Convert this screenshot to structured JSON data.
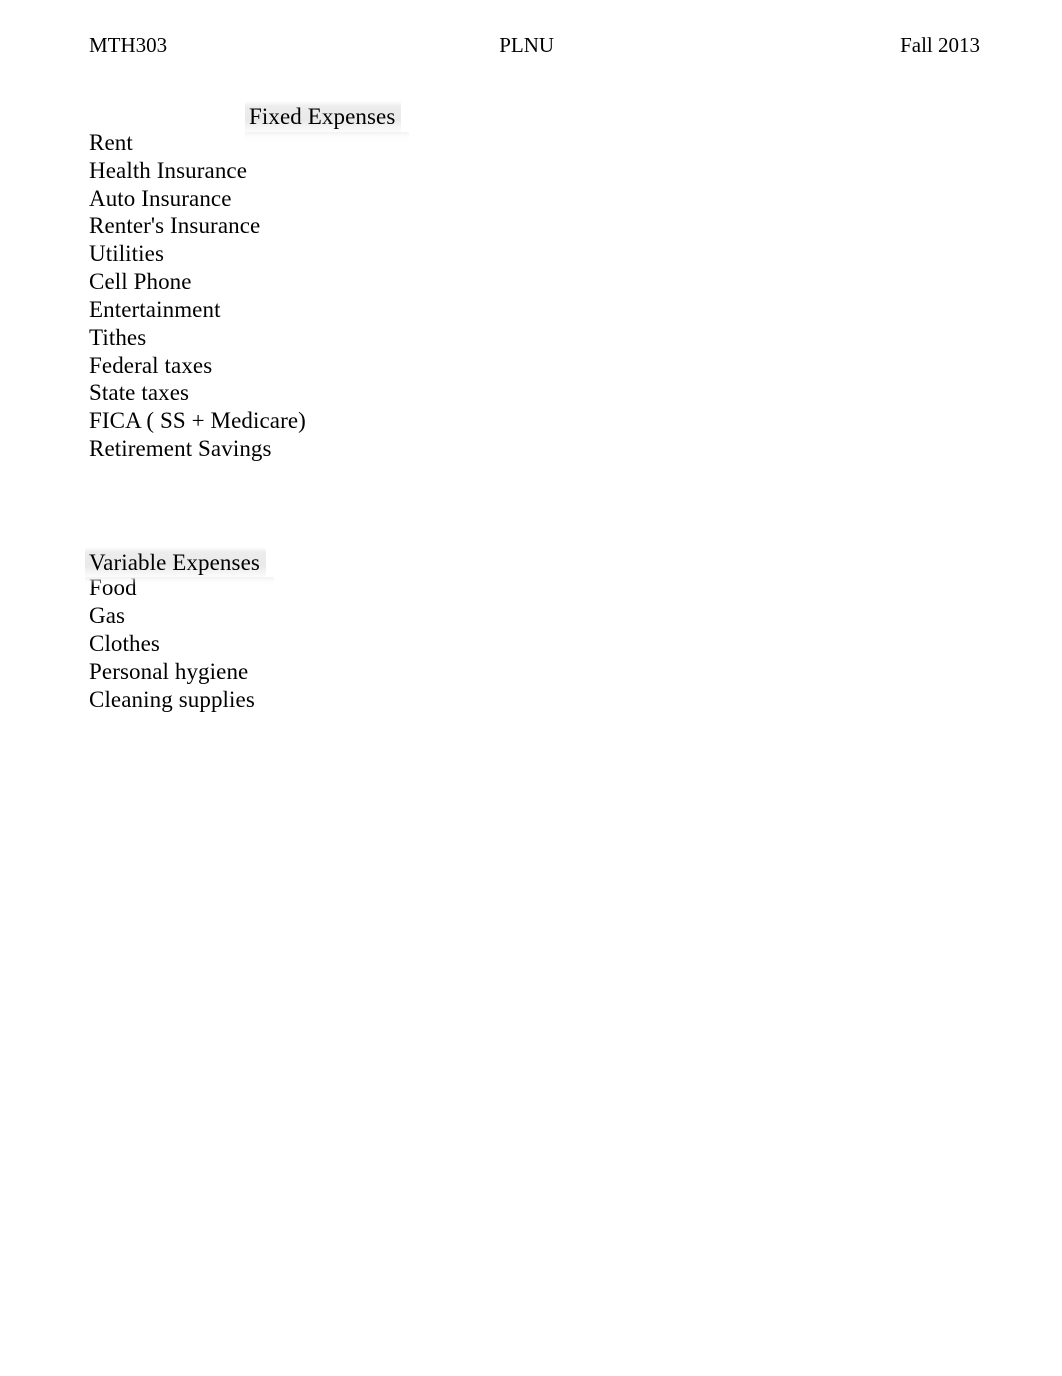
{
  "header": {
    "course_code": "MTH303",
    "institution": "PLNU",
    "term": "Fall 2013"
  },
  "sections": [
    {
      "title": "Fixed Expenses",
      "items": [
        "Rent",
        "Health Insurance",
        "Auto Insurance",
        "Renter's Insurance",
        "Utilities",
        "Cell Phone",
        "Entertainment",
        "Tithes",
        "Federal taxes",
        "State taxes",
        "FICA ( SS + Medicare)",
        "Retirement Savings"
      ]
    },
    {
      "title": "Variable Expenses",
      "items": [
        "Food",
        "Gas",
        "Clothes",
        "Personal hygiene",
        "Cleaning supplies"
      ]
    }
  ]
}
